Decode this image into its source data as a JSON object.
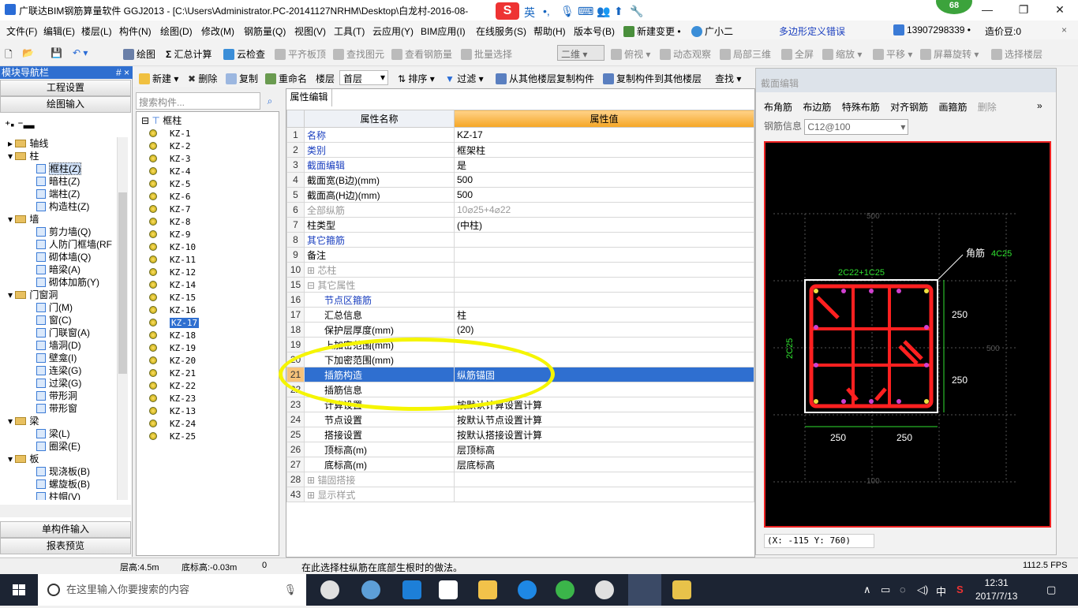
{
  "window": {
    "title": "广联达BIM钢筋算量软件 GGJ2013 - [C:\\Users\\Administrator.PC-20141127NRHM\\Desktop\\白龙村-2016-08-",
    "badge": "68",
    "ime_label": "英",
    "controls": [
      "—",
      "❐",
      "✕"
    ]
  },
  "menu": {
    "items": [
      "文件(F)",
      "编辑(E)",
      "楼层(L)",
      "构件(N)",
      "绘图(D)",
      "修改(M)",
      "钢筋量(Q)",
      "视图(V)",
      "工具(T)",
      "云应用(Y)",
      "BIM应用(I)",
      "在线服务(S)",
      "帮助(H)",
      "版本号(B)",
      "新建变更 •",
      "广小二"
    ],
    "notice": "多边形定义错误",
    "phone": "13907298339 •",
    "coins": "造价豆:0"
  },
  "toolbar": {
    "draw": "绘图",
    "calc": "汇总计算",
    "cloud": "云检查",
    "level": "平齐板顶",
    "find": "查找图元",
    "view_qty": "查看钢筋量",
    "batch": "批量选择",
    "view2d": "二维",
    "top": "俯视",
    "orbit": "动态观察",
    "local3d": "局部三维",
    "fullscreen": "全屏",
    "zoom": "缩放",
    "pan": "平移",
    "rotate": "屏幕旋转",
    "select_layer": "选择楼层"
  },
  "left": {
    "header": "模块导航栏",
    "pin": "#  ×",
    "btn_settings": "工程设置",
    "btn_draw": "绘图输入",
    "btn_single": "单构件输入",
    "btn_report": "报表预览",
    "tree": [
      {
        "label": "轴线",
        "level": 1,
        "type": "folder"
      },
      {
        "label": "柱",
        "level": 1,
        "type": "folder"
      },
      {
        "label": "框柱(Z)",
        "level": 2,
        "type": "item",
        "selected": true
      },
      {
        "label": "暗柱(Z)",
        "level": 2,
        "type": "item"
      },
      {
        "label": "端柱(Z)",
        "level": 2,
        "type": "item"
      },
      {
        "label": "构造柱(Z)",
        "level": 2,
        "type": "item"
      },
      {
        "label": "墙",
        "level": 1,
        "type": "folder"
      },
      {
        "label": "剪力墙(Q)",
        "level": 2,
        "type": "item"
      },
      {
        "label": "人防门框墙(RF",
        "level": 2,
        "type": "item"
      },
      {
        "label": "砌体墙(Q)",
        "level": 2,
        "type": "item"
      },
      {
        "label": "暗梁(A)",
        "level": 2,
        "type": "item"
      },
      {
        "label": "砌体加筋(Y)",
        "level": 2,
        "type": "item"
      },
      {
        "label": "门窗洞",
        "level": 1,
        "type": "folder"
      },
      {
        "label": "门(M)",
        "level": 2,
        "type": "item"
      },
      {
        "label": "窗(C)",
        "level": 2,
        "type": "item"
      },
      {
        "label": "门联窗(A)",
        "level": 2,
        "type": "item"
      },
      {
        "label": "墙洞(D)",
        "level": 2,
        "type": "item"
      },
      {
        "label": "壁龛(I)",
        "level": 2,
        "type": "item"
      },
      {
        "label": "连梁(G)",
        "level": 2,
        "type": "item"
      },
      {
        "label": "过梁(G)",
        "level": 2,
        "type": "item"
      },
      {
        "label": "带形洞",
        "level": 2,
        "type": "item"
      },
      {
        "label": "带形窗",
        "level": 2,
        "type": "item"
      },
      {
        "label": "梁",
        "level": 1,
        "type": "folder"
      },
      {
        "label": "梁(L)",
        "level": 2,
        "type": "item"
      },
      {
        "label": "圈梁(E)",
        "level": 2,
        "type": "item"
      },
      {
        "label": "板",
        "level": 1,
        "type": "folder"
      },
      {
        "label": "现浇板(B)",
        "level": 2,
        "type": "item"
      },
      {
        "label": "螺旋板(B)",
        "level": 2,
        "type": "item"
      },
      {
        "label": "柱帽(V)",
        "level": 2,
        "type": "item"
      }
    ]
  },
  "list": {
    "search_placeholder": "搜索构件...",
    "root": "框柱",
    "items": [
      "KZ-1",
      "KZ-2",
      "KZ-3",
      "KZ-4",
      "KZ-5",
      "KZ-6",
      "KZ-7",
      "KZ-8",
      "KZ-9",
      "KZ-10",
      "KZ-11",
      "KZ-12",
      "KZ-14",
      "KZ-15",
      "KZ-16",
      "KZ-17",
      "KZ-18",
      "KZ-19",
      "KZ-20",
      "KZ-21",
      "KZ-22",
      "KZ-23",
      "KZ-13",
      "KZ-24",
      "KZ-25"
    ],
    "selected": "KZ-17"
  },
  "comp_toolbar": {
    "new": "新建",
    "delete": "删除",
    "copy": "复制",
    "rename": "重命名",
    "floor_label": "楼层",
    "floor_value": "首层",
    "sort": "排序",
    "filter": "过滤",
    "copy_from": "从其他楼层复制构件",
    "copy_to": "复制构件到其他楼层",
    "find": "查找"
  },
  "props": {
    "tab": "属性编辑",
    "col_name": "属性名称",
    "col_value": "属性值",
    "rows": [
      {
        "n": "1",
        "k": "名称",
        "v": "KZ-17",
        "style": "blue"
      },
      {
        "n": "2",
        "k": "类别",
        "v": "框架柱",
        "style": "blue"
      },
      {
        "n": "3",
        "k": "截面编辑",
        "v": "是",
        "style": "blue"
      },
      {
        "n": "4",
        "k": "截面宽(B边)(mm)",
        "v": "500",
        "style": ""
      },
      {
        "n": "5",
        "k": "截面高(H边)(mm)",
        "v": "500",
        "style": ""
      },
      {
        "n": "6",
        "k": "全部纵筋",
        "v": "10⌀25+4⌀22",
        "style": "grey"
      },
      {
        "n": "7",
        "k": "柱类型",
        "v": "(中柱)",
        "style": ""
      },
      {
        "n": "8",
        "k": "其它箍筋",
        "v": "",
        "style": "blue"
      },
      {
        "n": "9",
        "k": "备注",
        "v": "",
        "style": ""
      },
      {
        "n": "10",
        "k": "⊞ 芯柱",
        "v": "",
        "style": "grey"
      },
      {
        "n": "15",
        "k": "⊟ 其它属性",
        "v": "",
        "style": "grey"
      },
      {
        "n": "16",
        "k": "节点区箍筋",
        "v": "",
        "style": "blue sub"
      },
      {
        "n": "17",
        "k": "汇总信息",
        "v": "柱",
        "style": "sub"
      },
      {
        "n": "18",
        "k": "保护层厚度(mm)",
        "v": "(20)",
        "style": "sub"
      },
      {
        "n": "19",
        "k": "上加密范围(mm)",
        "v": "",
        "style": "sub"
      },
      {
        "n": "20",
        "k": "下加密范围(mm)",
        "v": "",
        "style": "sub"
      },
      {
        "n": "21",
        "k": "插筋构造",
        "v": "纵筋锚固",
        "style": "sub sel"
      },
      {
        "n": "22",
        "k": "插筋信息",
        "v": "",
        "style": "sub"
      },
      {
        "n": "23",
        "k": "计算设置",
        "v": "按默认计算设置计算",
        "style": "sub"
      },
      {
        "n": "24",
        "k": "节点设置",
        "v": "按默认节点设置计算",
        "style": "sub"
      },
      {
        "n": "25",
        "k": "搭接设置",
        "v": "按默认搭接设置计算",
        "style": "sub"
      },
      {
        "n": "26",
        "k": "顶标高(m)",
        "v": "层顶标高",
        "style": "sub"
      },
      {
        "n": "27",
        "k": "底标高(m)",
        "v": "层底标高",
        "style": "sub"
      },
      {
        "n": "28",
        "k": "⊞ 锚固搭接",
        "v": "",
        "style": "grey"
      },
      {
        "n": "43",
        "k": "⊞ 显示样式",
        "v": "",
        "style": "grey"
      }
    ]
  },
  "section": {
    "title": "截面编辑",
    "tools": [
      "布角筋",
      "布边筋",
      "特殊布筋",
      "对齐钢筋",
      "画箍筋",
      "删除"
    ],
    "rebar_label": "钢筋信息",
    "rebar_value": "C12@100",
    "labels": {
      "corner": "角筋",
      "corner_val": "4C25",
      "top": "2C22+1C25",
      "side": "2C25",
      "dim_right_top": "250",
      "dim_right_bot": "250",
      "dim_bot_left": "250",
      "dim_bot_right": "250",
      "grid_top": "500",
      "grid_right": "500",
      "grid_bottom": "100"
    },
    "coord": "(X: -115 Y: 760)"
  },
  "status": {
    "floor_height": "层高:4.5m",
    "bottom_elev": "底标高:-0.03m",
    "zero": "0",
    "hint": "在此选择柱纵筋在底部生根时的做法。",
    "fps": "1112.5 FPS"
  },
  "taskbar": {
    "search_placeholder": "在这里输入你要搜索的内容",
    "time": "12:31",
    "date": "2017/7/13",
    "lang": "中"
  },
  "colors": {
    "accent": "#2f6fd0",
    "rebar": "#ff2020",
    "highlight": "#f5f500"
  }
}
